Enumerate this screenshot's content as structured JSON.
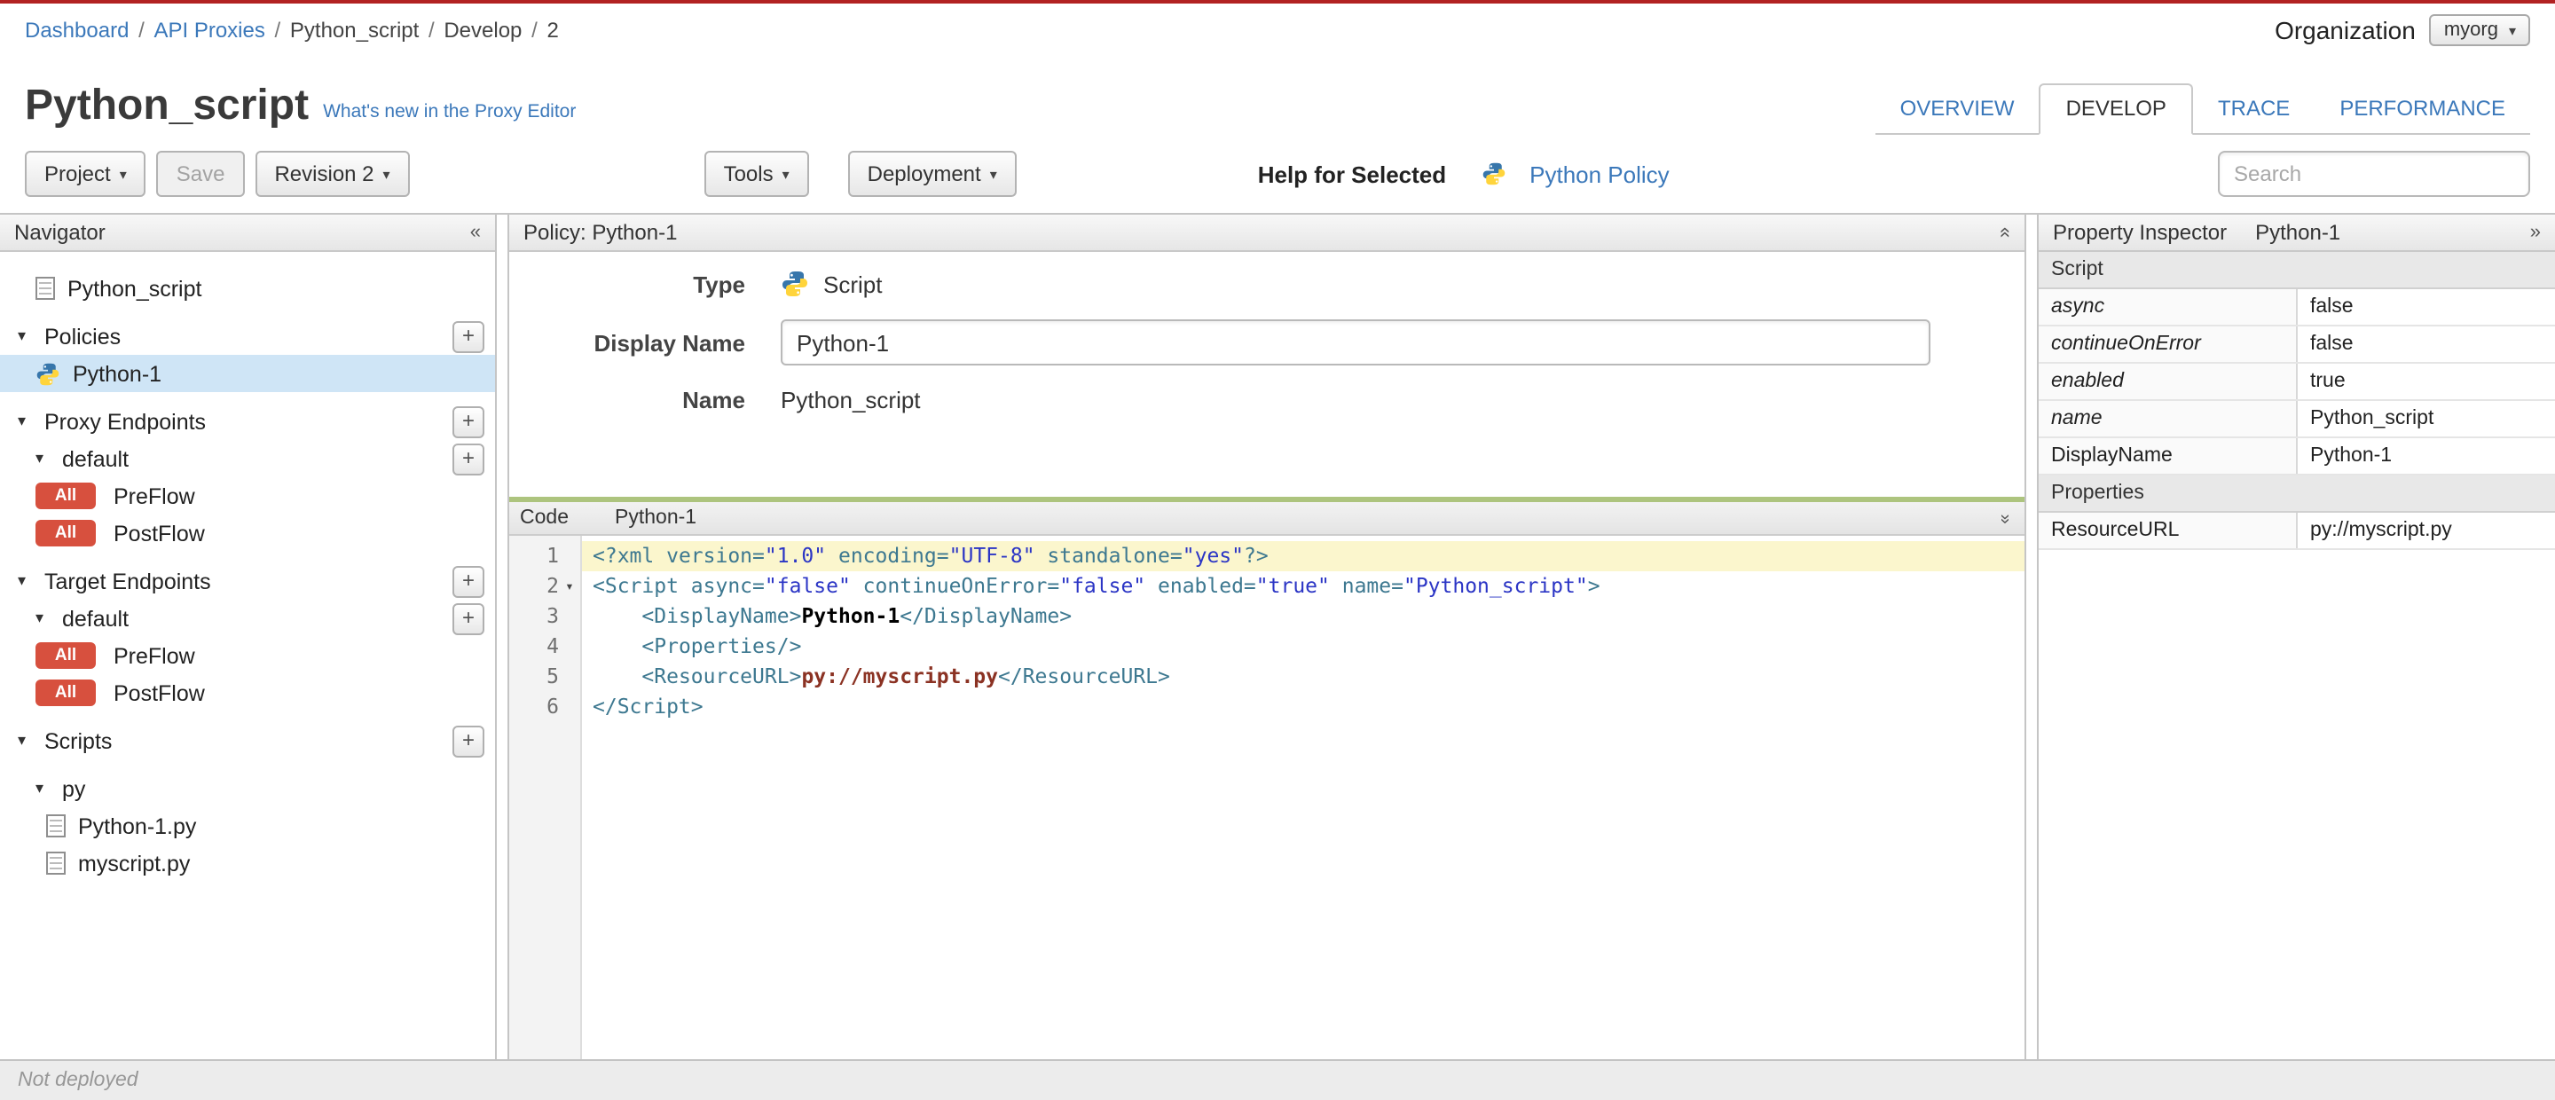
{
  "breadcrumb": {
    "separator": "/",
    "items": [
      {
        "label": "Dashboard",
        "link": true
      },
      {
        "label": "API Proxies",
        "link": true
      },
      {
        "label": "Python_script",
        "link": false
      },
      {
        "label": "Develop",
        "link": false
      },
      {
        "label": "2",
        "link": false
      }
    ]
  },
  "organization": {
    "label": "Organization",
    "value": "myorg"
  },
  "header": {
    "title": "Python_script",
    "whats_new_link": "What's new in the Proxy Editor",
    "tabs": [
      {
        "label": "OVERVIEW",
        "active": false
      },
      {
        "label": "DEVELOP",
        "active": true
      },
      {
        "label": "TRACE",
        "active": false
      },
      {
        "label": "PERFORMANCE",
        "active": false
      }
    ]
  },
  "toolbar": {
    "project_button": "Project",
    "save_button": "Save",
    "revision_button": "Revision 2",
    "tools_button": "Tools",
    "deployment_button": "Deployment",
    "help_for_selected": "Help for Selected",
    "policy_help_link": "Python Policy",
    "search_placeholder": "Search"
  },
  "navigator": {
    "title": "Navigator",
    "collapse_icon": "«",
    "items": [
      {
        "label": "Python_script",
        "icon": "file",
        "indent": 1,
        "group_start": true
      },
      {
        "label": "Policies",
        "caret": true,
        "plus": true,
        "indent": 0,
        "group_start": true
      },
      {
        "label": "Python-1",
        "icon": "python",
        "indent": 1,
        "selected": true
      },
      {
        "label": "Proxy Endpoints",
        "caret": true,
        "plus": true,
        "indent": 0,
        "group_start": true
      },
      {
        "label": "default",
        "caret": true,
        "plus": true,
        "indent": 1
      },
      {
        "label": "PreFlow",
        "badge": "All",
        "indent": 1
      },
      {
        "label": "PostFlow",
        "badge": "All",
        "indent": 1
      },
      {
        "label": "Target Endpoints",
        "caret": true,
        "plus": true,
        "indent": 0,
        "group_start": true
      },
      {
        "label": "default",
        "caret": true,
        "plus": true,
        "indent": 1
      },
      {
        "label": "PreFlow",
        "badge": "All",
        "indent": 1
      },
      {
        "label": "PostFlow",
        "badge": "All",
        "indent": 1
      },
      {
        "label": "Scripts",
        "caret": true,
        "plus": true,
        "indent": 0,
        "group_start": true
      },
      {
        "label": "py",
        "caret": true,
        "indent": 1,
        "group_start": true
      },
      {
        "label": "Python-1.py",
        "icon": "file",
        "indent": 2
      },
      {
        "label": "myscript.py",
        "icon": "file",
        "indent": 2
      }
    ]
  },
  "policy_panel": {
    "title": "Policy: Python-1",
    "type_label": "Type",
    "type_value": "Script",
    "display_name_label": "Display Name",
    "display_name_value": "Python-1",
    "name_label": "Name",
    "name_value": "Python_script"
  },
  "code_panel": {
    "tab_label": "Code",
    "file_label": "Python-1",
    "lines": [
      {
        "num": "1",
        "active": true,
        "tokens": [
          [
            "tag",
            "<?xml "
          ],
          [
            "attr",
            "version="
          ],
          [
            "str",
            "\"1.0\""
          ],
          [
            "attr",
            " encoding="
          ],
          [
            "str",
            "\"UTF-8\""
          ],
          [
            "attr",
            " standalone="
          ],
          [
            "str",
            "\"yes\""
          ],
          [
            "tag",
            "?>"
          ]
        ]
      },
      {
        "num": "2",
        "fold": true,
        "tokens": [
          [
            "tag",
            "<Script "
          ],
          [
            "attr",
            "async="
          ],
          [
            "str",
            "\"false\""
          ],
          [
            "attr",
            " continueOnError="
          ],
          [
            "str",
            "\"false\""
          ],
          [
            "attr",
            " enabled="
          ],
          [
            "str",
            "\"true\""
          ],
          [
            "attr",
            " name="
          ],
          [
            "str",
            "\"Python_script\""
          ],
          [
            "tag",
            ">"
          ]
        ]
      },
      {
        "num": "3",
        "tokens": [
          [
            "plain",
            "    "
          ],
          [
            "tag",
            "<DisplayName>"
          ],
          [
            "text",
            "Python-1"
          ],
          [
            "tag",
            "</DisplayName>"
          ]
        ]
      },
      {
        "num": "4",
        "tokens": [
          [
            "plain",
            "    "
          ],
          [
            "tag",
            "<Properties/>"
          ]
        ]
      },
      {
        "num": "5",
        "tokens": [
          [
            "plain",
            "    "
          ],
          [
            "tag",
            "<ResourceURL>"
          ],
          [
            "res",
            "py://myscript.py"
          ],
          [
            "tag",
            "</ResourceURL>"
          ]
        ]
      },
      {
        "num": "6",
        "tokens": [
          [
            "tag",
            "</Script>"
          ]
        ]
      }
    ]
  },
  "inspector": {
    "title": "Property Inspector",
    "subtitle": "Python-1",
    "expand_icon": "»",
    "rows": [
      {
        "section": true,
        "label": "Script"
      },
      {
        "label": "async",
        "italic": true,
        "value": "false"
      },
      {
        "label": "continueOnError",
        "italic": true,
        "value": "false"
      },
      {
        "label": "enabled",
        "italic": true,
        "value": "true"
      },
      {
        "label": "name",
        "italic": true,
        "value": "Python_script"
      },
      {
        "label": "DisplayName",
        "italic": false,
        "value": "Python-1"
      },
      {
        "section": true,
        "label": "Properties"
      },
      {
        "label": "ResourceURL",
        "italic": false,
        "value": "py://myscript.py"
      }
    ]
  },
  "statusbar": {
    "text": "Not deployed"
  }
}
